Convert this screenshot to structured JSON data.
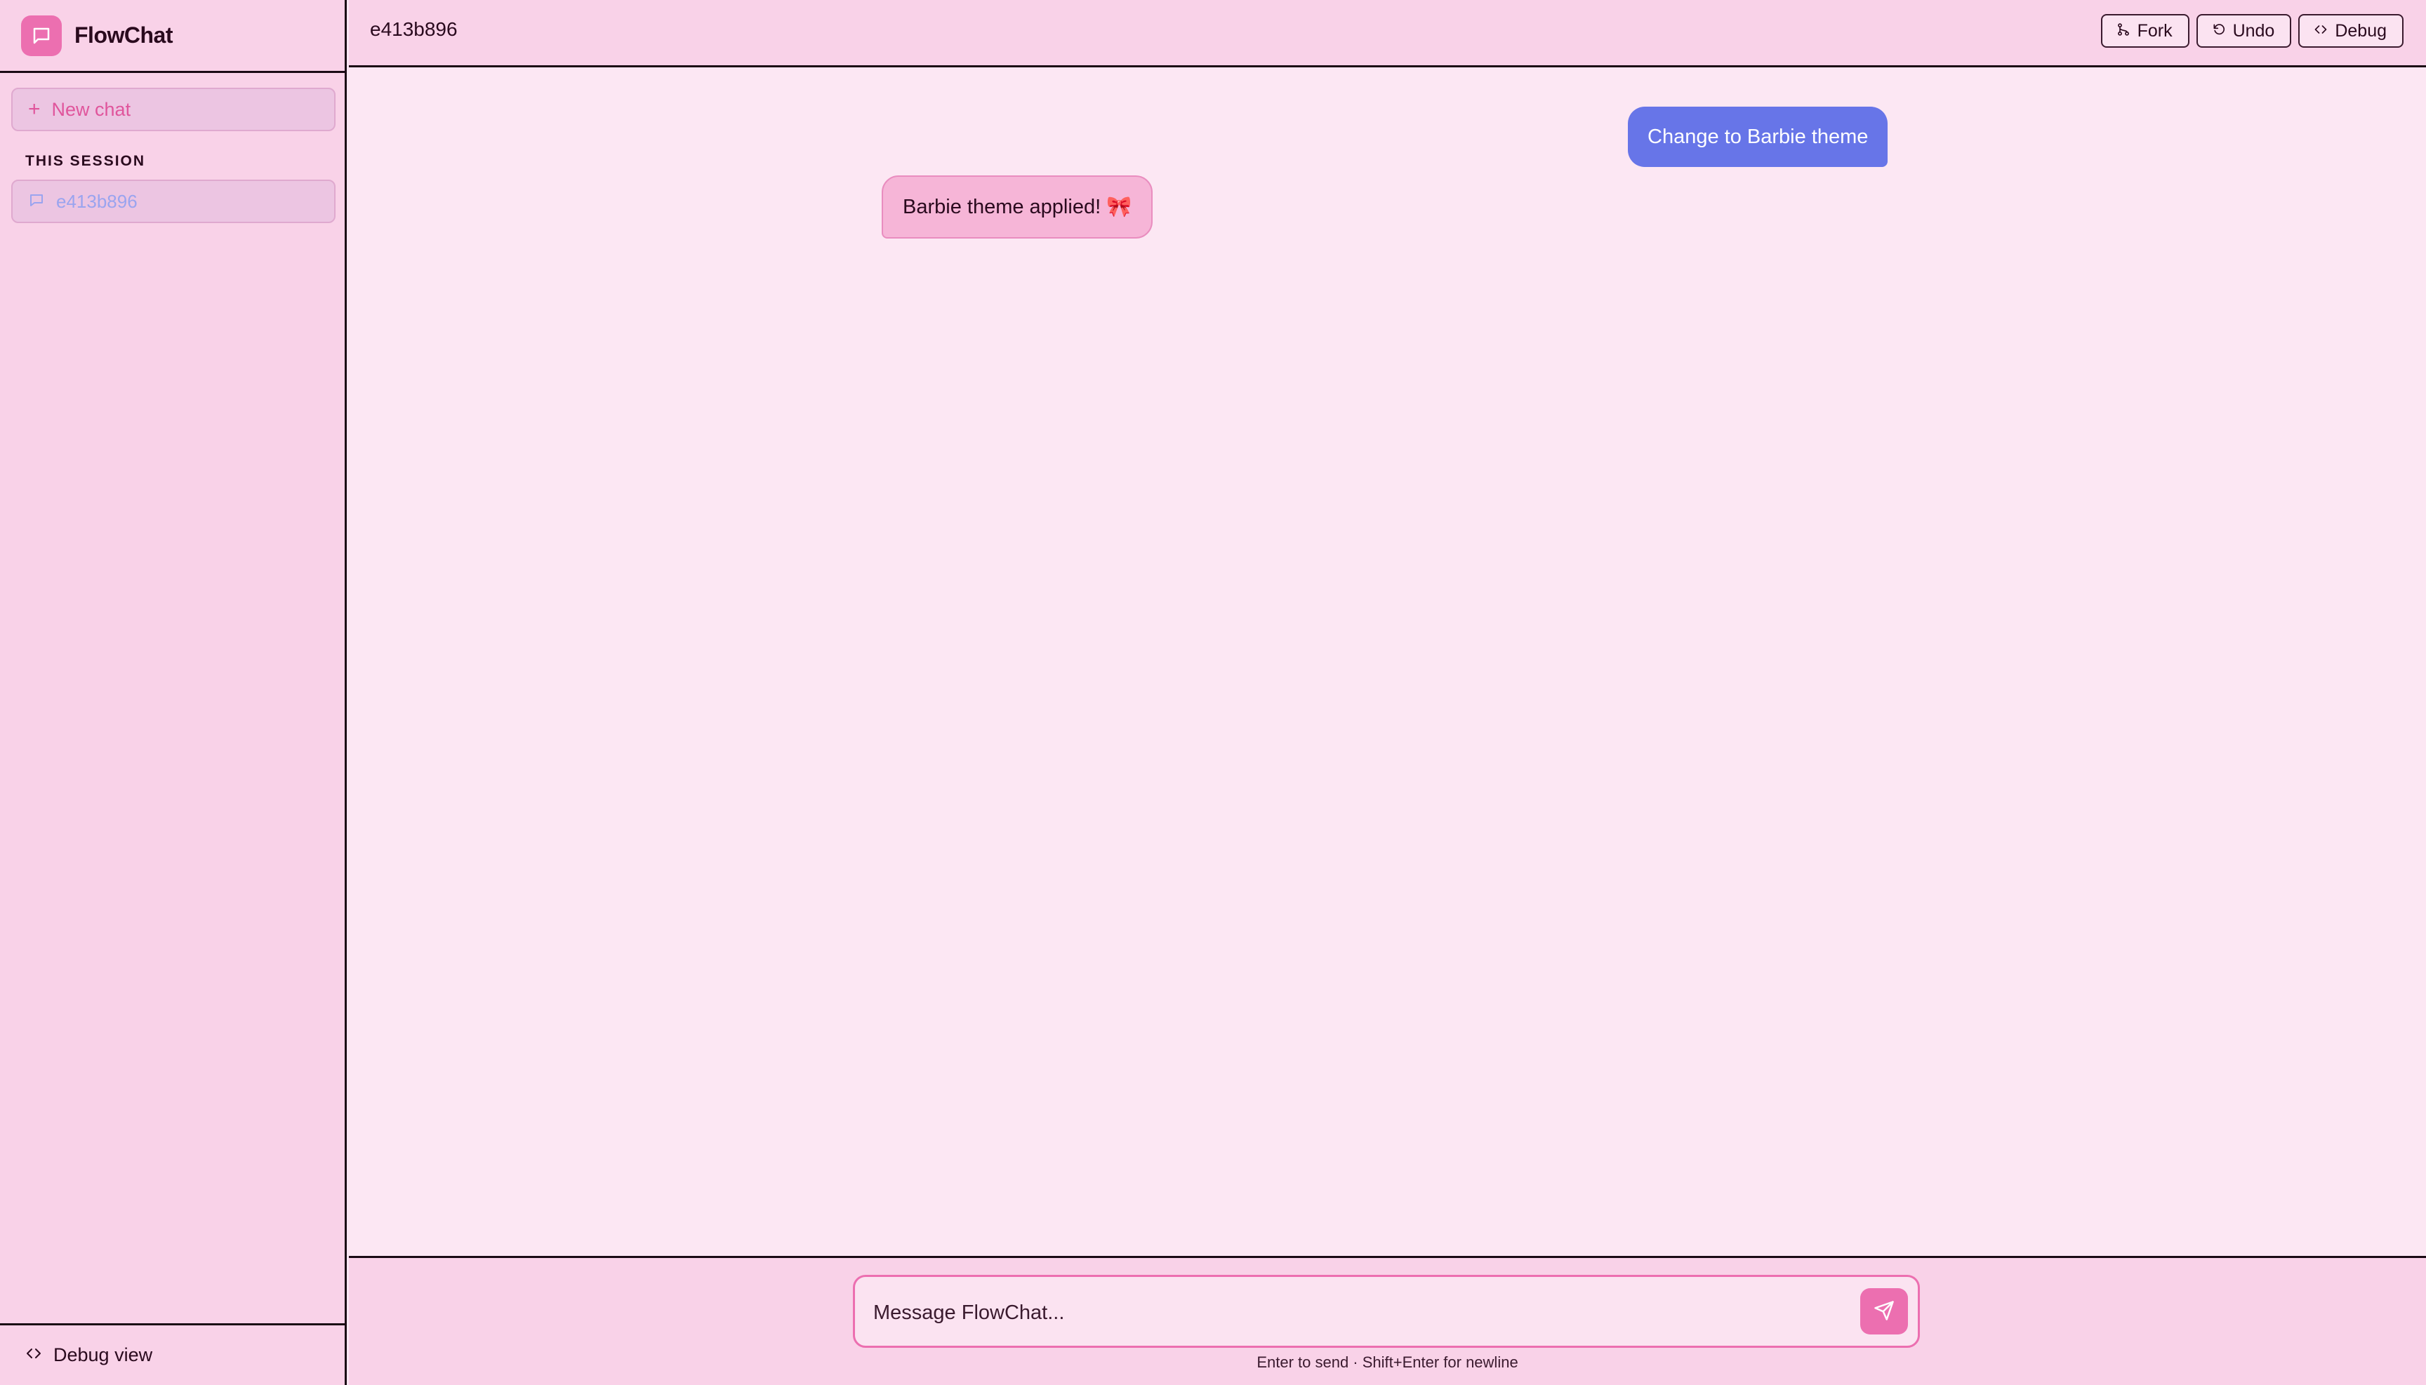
{
  "app": {
    "name": "FlowChat"
  },
  "sidebar": {
    "new_chat_label": "New chat",
    "section_label": "THIS SESSION",
    "sessions": [
      {
        "label": "e413b896",
        "icon": "chat-bubble-icon"
      }
    ],
    "debug_view_label": "Debug view"
  },
  "header": {
    "title": "e413b896",
    "buttons": [
      {
        "label": "Fork",
        "icon": "fork-icon"
      },
      {
        "label": "Undo",
        "icon": "undo-icon"
      },
      {
        "label": "Debug",
        "icon": "code-icon"
      }
    ]
  },
  "messages": [
    {
      "role": "user",
      "text": "Change to Barbie theme"
    },
    {
      "role": "assistant",
      "text": "Barbie theme applied! 🎀"
    }
  ],
  "composer": {
    "placeholder": "Message FlowChat...",
    "hint": "Enter to send · Shift+Enter for newline"
  },
  "colors": {
    "accent": "#ec6fb0",
    "user_bubble": "#6775e8",
    "assistant_bubble": "#f6b5d7",
    "background": "#fce7f3",
    "panel": "#f9d2e8"
  }
}
